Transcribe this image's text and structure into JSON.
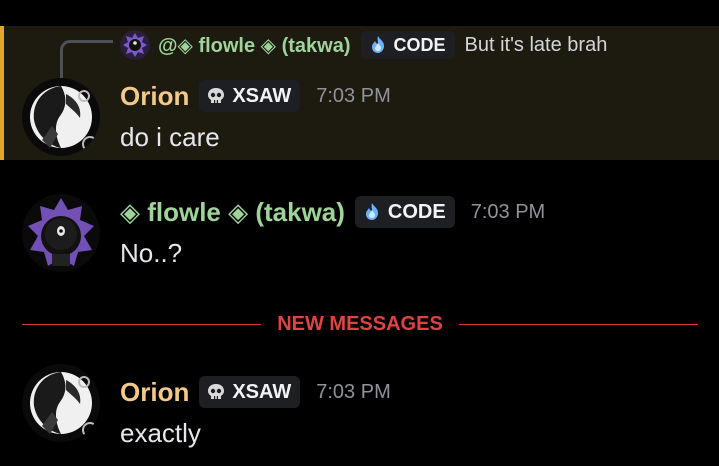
{
  "colors": {
    "orion_name": "#f2c98b",
    "flowle_name": "#9fd39a",
    "highlight_bar": "#e3a72a",
    "new_messages": "#e04343",
    "background": "#000000"
  },
  "messages": [
    {
      "reply": {
        "author": "@◈ flowle ◈ (takwa)",
        "tag_icon": "blue-flame-icon",
        "tag_label": "CODE",
        "text": "But it's late brah"
      },
      "author": "Orion",
      "tag_icon": "skull-icon",
      "tag_label": "XSAW",
      "time": "7:03 PM",
      "text": "do i care"
    },
    {
      "author": "◈ flowle ◈ (takwa)",
      "tag_icon": "blue-flame-icon",
      "tag_label": "CODE",
      "time": "7:03 PM",
      "text": "No..?"
    },
    {
      "author": "Orion",
      "tag_icon": "skull-icon",
      "tag_label": "XSAW",
      "time": "7:03 PM",
      "text": "exactly"
    }
  ],
  "divider": {
    "label": "NEW MESSAGES"
  }
}
